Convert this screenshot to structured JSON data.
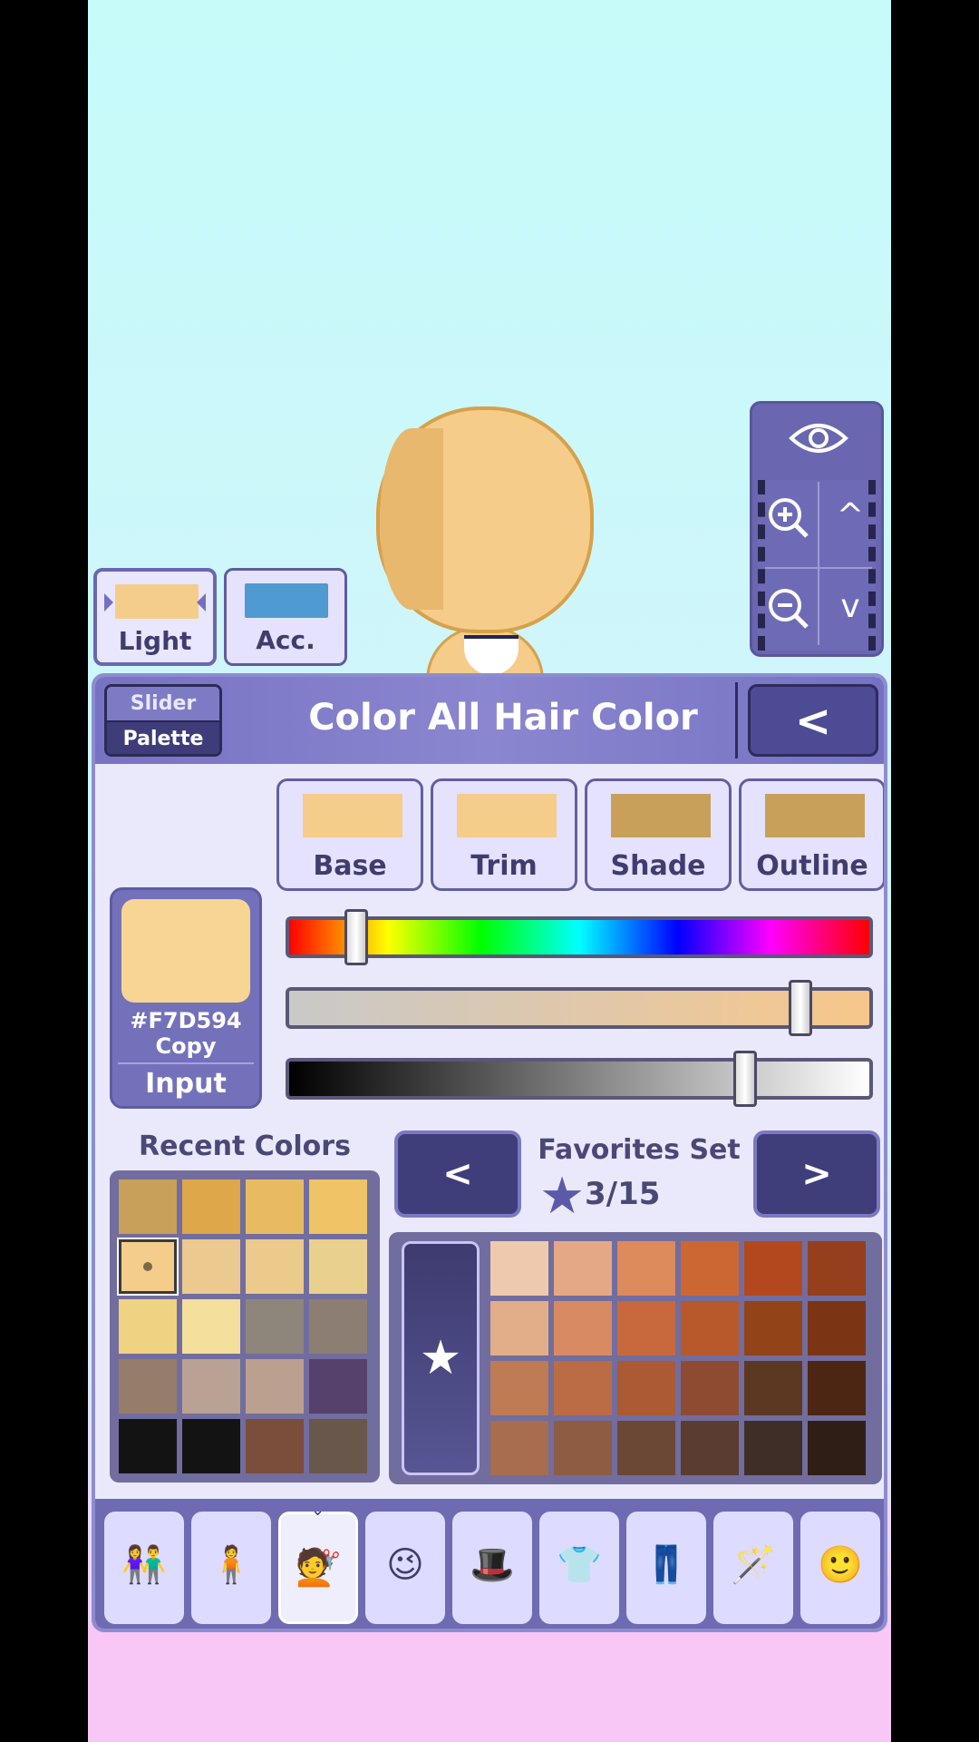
{
  "top_controls": {
    "light_label": "Light",
    "acc_label": "Acc.",
    "light_color": "#f5cd8b",
    "acc_color": "#4e9ad1"
  },
  "zoom": {
    "eye_icon": "eye-icon",
    "zoom_in_icon": "zoom-in-icon",
    "zoom_out_icon": "zoom-out-icon",
    "up_label": "^",
    "down_label": "v"
  },
  "header": {
    "mode_slider": "Slider",
    "mode_palette": "Palette",
    "title": "Color All Hair Color",
    "back_label": "<"
  },
  "layers": [
    {
      "label": "Base",
      "color": "#f5cd8b"
    },
    {
      "label": "Trim",
      "color": "#f5cd8b"
    },
    {
      "label": "Shade",
      "color": "#c8a05a"
    },
    {
      "label": "Outline",
      "color": "#c8a05a"
    }
  ],
  "preview": {
    "color": "#F7D594",
    "hex": "#F7D594",
    "copy_label": "Copy",
    "input_label": "Input"
  },
  "sliders": {
    "hue_level": 0.1,
    "saturation_level": 0.9,
    "value_level": 0.8
  },
  "recent": {
    "title": "Recent Colors",
    "colors": [
      "#c8a05a",
      "#dea749",
      "#e8bb62",
      "#efc366",
      "#f5cd8b",
      "#ebc98f",
      "#ebca8b",
      "#ead08f",
      "#efd282",
      "#f4df9c",
      "#8e857b",
      "#8c7e72",
      "#957d6a",
      "#b9a294",
      "#bca08f",
      "#55416c",
      "#131313",
      "#131313",
      "#7a4e3a",
      "#6a574b"
    ],
    "selected_index": 4
  },
  "favorites": {
    "title": "Favorites Set",
    "count": "3/15",
    "prev_label": "<",
    "next_label": ">",
    "colors": [
      "#efc9ae",
      "#e5a886",
      "#dd8a5c",
      "#cc6733",
      "#b3481f",
      "#953f1c",
      "#e2ae8a",
      "#d88a62",
      "#c7693d",
      "#b8592c",
      "#934318",
      "#7b3515",
      "#bf7b53",
      "#bb6c45",
      "#ab5a34",
      "#8f4a32",
      "#5c3823",
      "#4c2613",
      "#a86c4f",
      "#8d5c43",
      "#6b4736",
      "#5a3c30",
      "#3f2e28",
      "#2e1e15"
    ]
  },
  "tabs": [
    {
      "name": "characters-tab-icon",
      "glyph": "👫"
    },
    {
      "name": "body-tab-icon",
      "glyph": "🧍"
    },
    {
      "name": "hair-tab-icon",
      "glyph": "💇"
    },
    {
      "name": "face-tab-icon",
      "glyph": "😉"
    },
    {
      "name": "accessories-tab-icon",
      "glyph": "🎩"
    },
    {
      "name": "top-clothing-tab-icon",
      "glyph": "👕"
    },
    {
      "name": "bottom-clothing-tab-icon",
      "glyph": "👖"
    },
    {
      "name": "props-tab-icon",
      "glyph": "🪄"
    },
    {
      "name": "profile-tab-icon",
      "glyph": "🙂"
    }
  ]
}
